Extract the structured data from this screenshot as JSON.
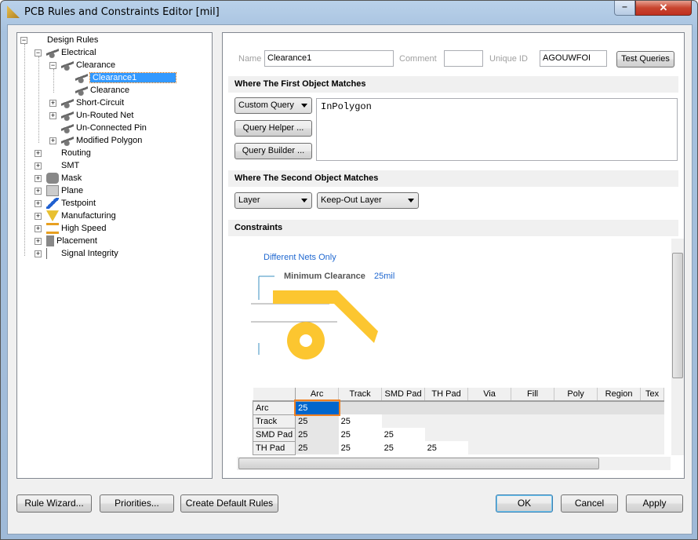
{
  "window": {
    "title": "PCB Rules and Constraints Editor [mil]",
    "close": "✕",
    "minimize": "–"
  },
  "tree": {
    "root": "Design Rules",
    "electrical": "Electrical",
    "clearance": "Clearance",
    "clearance_children": [
      "Clearance1",
      "Clearance"
    ],
    "electrical_children": [
      "Short-Circuit",
      "Un-Routed Net",
      "Un-Connected Pin",
      "Modified Polygon"
    ],
    "categories": [
      "Routing",
      "SMT",
      "Mask",
      "Plane",
      "Testpoint",
      "Manufacturing",
      "High Speed",
      "Placement",
      "Signal Integrity"
    ]
  },
  "rule": {
    "name_label": "Name",
    "name_value": "Clearance1",
    "comment_label": "Comment",
    "comment_value": "",
    "uid_label": "Unique ID",
    "uid_value": "AGOUWFOI",
    "test_queries": "Test Queries"
  },
  "first": {
    "heading": "Where The First Object Matches",
    "query_type": "Custom Query",
    "helper": "Query Helper ...",
    "builder": "Query Builder ...",
    "query": "InPolygon"
  },
  "second": {
    "heading": "Where The Second Object Matches",
    "type": "Layer",
    "layer": "Keep-Out Layer"
  },
  "constraints": {
    "heading": "Constraints",
    "different_nets": "Different Nets Only",
    "min_clearance_label": "Minimum Clearance",
    "min_clearance_value": "25mil",
    "columns": [
      "Arc",
      "Track",
      "SMD Pad",
      "TH Pad",
      "Via",
      "Fill",
      "Poly",
      "Region",
      "Tex"
    ],
    "rows": [
      {
        "label": "Arc",
        "values": [
          "25"
        ]
      },
      {
        "label": "Track",
        "values": [
          "25",
          "25"
        ]
      },
      {
        "label": "SMD Pad",
        "values": [
          "25",
          "25",
          "25"
        ]
      },
      {
        "label": "TH Pad",
        "values": [
          "25",
          "25",
          "25",
          "25"
        ]
      }
    ]
  },
  "buttons": {
    "wizard": "Rule Wizard...",
    "priorities": "Priorities...",
    "defaults": "Create Default Rules",
    "ok": "OK",
    "cancel": "Cancel",
    "apply": "Apply"
  },
  "colors": {
    "selection": "#3399ff",
    "copper": "#fcc630",
    "link": "#2068d0"
  }
}
